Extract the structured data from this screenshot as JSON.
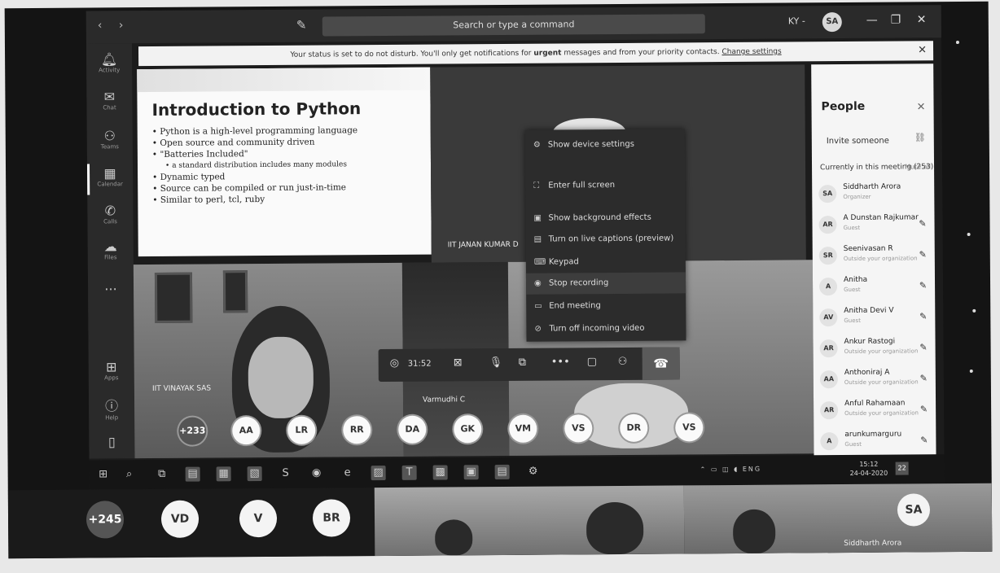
{
  "topbar": {
    "nav": "‹  ›",
    "search_placeholder": "Search or type a command",
    "account": "KY -",
    "user_initials": "SA"
  },
  "rail": {
    "items": [
      {
        "icon": "bell-icon",
        "label": "Activity"
      },
      {
        "icon": "chat-icon",
        "label": "Chat"
      },
      {
        "icon": "teams-icon",
        "label": "Teams"
      },
      {
        "icon": "calendar-icon",
        "label": "Calendar"
      },
      {
        "icon": "calls-icon",
        "label": "Calls"
      },
      {
        "icon": "files-icon",
        "label": "Files"
      },
      {
        "icon": "more-icon",
        "label": "..."
      },
      {
        "icon": "apps-icon",
        "label": "Apps"
      },
      {
        "icon": "help-icon",
        "label": "Help"
      }
    ]
  },
  "banner": {
    "text": "Your status is set to do not disturb. You'll only get notifications for",
    "emph": "urgent",
    "text2": "messages and from your priority contacts.",
    "link": "Change settings"
  },
  "slide": {
    "title": "Introduction to Python",
    "bullets": [
      "• Python is a high-level programming language",
      "• Open source and community driven",
      "• \"Batteries Included\"",
      "• a standard distribution includes many modules",
      "• Dynamic typed",
      "• Source can be compiled or run just-in-time",
      "• Similar to perl, tcl, ruby"
    ]
  },
  "video_labels": {
    "presenter": "IIT JANAN KUMAR D",
    "cam_left": "IIT VINAYAK SAS",
    "cam_mid": "Varmudhi C"
  },
  "menu": {
    "items": [
      {
        "label": "Show device settings",
        "icon": "⚙"
      },
      {
        "label": "Enter full screen",
        "icon": "⛶"
      },
      {
        "label": "Show background effects",
        "icon": "▣"
      },
      {
        "label": "Turn on live captions (preview)",
        "icon": "▤"
      },
      {
        "label": "Keypad",
        "icon": "⌨"
      },
      {
        "label": "Stop recording",
        "icon": "◉"
      },
      {
        "label": "End meeting",
        "icon": "▭"
      },
      {
        "label": "Turn off incoming video",
        "icon": "⊘"
      }
    ]
  },
  "callbar": {
    "time": "31:52"
  },
  "people": {
    "title": "People",
    "invite": "Invite someone",
    "current": "Currently in this meeting (253)",
    "mute_all": "Mute all",
    "list": [
      {
        "initials": "SA",
        "name": "Siddharth Arora",
        "role": "Organizer"
      },
      {
        "initials": "AR",
        "name": "A Dunstan Rajkumar",
        "role": "Guest"
      },
      {
        "initials": "SR",
        "name": "Seenivasan R",
        "role": "Outside your organization"
      },
      {
        "initials": "A",
        "name": "Anitha",
        "role": "Guest"
      },
      {
        "initials": "AV",
        "name": "Anitha Devi V",
        "role": "Guest"
      },
      {
        "initials": "AR",
        "name": "Ankur Rastogi",
        "role": "Outside your organization"
      },
      {
        "initials": "AA",
        "name": "Anthoniraj A",
        "role": "Outside your organization"
      },
      {
        "initials": "AR",
        "name": "Anful Rahamaan",
        "role": "Outside your organization"
      },
      {
        "initials": "A",
        "name": "arunkumarguru",
        "role": "Guest"
      }
    ]
  },
  "bubbles": [
    "+233",
    "AA",
    "LR",
    "RR",
    "DA",
    "GK",
    "VM",
    "VS",
    "DR",
    "VS"
  ],
  "taskbar": {
    "lang": "ENG",
    "time": "15:12",
    "date": "24-04-2020",
    "notif": "22"
  },
  "lower": {
    "bubbles": [
      "+245",
      "VD",
      "V",
      "BR"
    ],
    "self_initials": "SA",
    "self_name": "Siddharth Arora"
  }
}
